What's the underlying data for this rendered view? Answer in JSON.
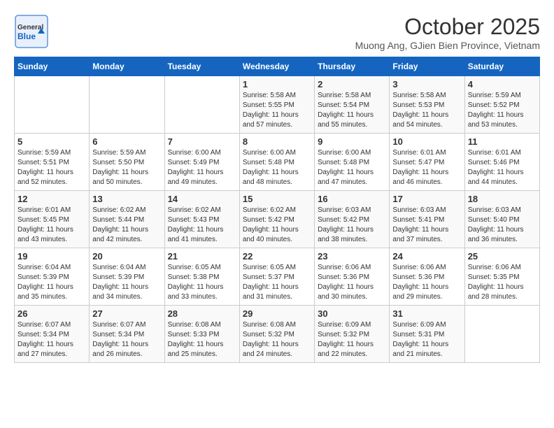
{
  "logo": {
    "line1": "General",
    "line2": "Blue"
  },
  "title": "October 2025",
  "location": "Muong Ang, GJien Bien Province, Vietnam",
  "days_of_week": [
    "Sunday",
    "Monday",
    "Tuesday",
    "Wednesday",
    "Thursday",
    "Friday",
    "Saturday"
  ],
  "weeks": [
    [
      {
        "day": "",
        "info": ""
      },
      {
        "day": "",
        "info": ""
      },
      {
        "day": "",
        "info": ""
      },
      {
        "day": "1",
        "info": "Sunrise: 5:58 AM\nSunset: 5:55 PM\nDaylight: 11 hours\nand 57 minutes."
      },
      {
        "day": "2",
        "info": "Sunrise: 5:58 AM\nSunset: 5:54 PM\nDaylight: 11 hours\nand 55 minutes."
      },
      {
        "day": "3",
        "info": "Sunrise: 5:58 AM\nSunset: 5:53 PM\nDaylight: 11 hours\nand 54 minutes."
      },
      {
        "day": "4",
        "info": "Sunrise: 5:59 AM\nSunset: 5:52 PM\nDaylight: 11 hours\nand 53 minutes."
      }
    ],
    [
      {
        "day": "5",
        "info": "Sunrise: 5:59 AM\nSunset: 5:51 PM\nDaylight: 11 hours\nand 52 minutes."
      },
      {
        "day": "6",
        "info": "Sunrise: 5:59 AM\nSunset: 5:50 PM\nDaylight: 11 hours\nand 50 minutes."
      },
      {
        "day": "7",
        "info": "Sunrise: 6:00 AM\nSunset: 5:49 PM\nDaylight: 11 hours\nand 49 minutes."
      },
      {
        "day": "8",
        "info": "Sunrise: 6:00 AM\nSunset: 5:48 PM\nDaylight: 11 hours\nand 48 minutes."
      },
      {
        "day": "9",
        "info": "Sunrise: 6:00 AM\nSunset: 5:48 PM\nDaylight: 11 hours\nand 47 minutes."
      },
      {
        "day": "10",
        "info": "Sunrise: 6:01 AM\nSunset: 5:47 PM\nDaylight: 11 hours\nand 46 minutes."
      },
      {
        "day": "11",
        "info": "Sunrise: 6:01 AM\nSunset: 5:46 PM\nDaylight: 11 hours\nand 44 minutes."
      }
    ],
    [
      {
        "day": "12",
        "info": "Sunrise: 6:01 AM\nSunset: 5:45 PM\nDaylight: 11 hours\nand 43 minutes."
      },
      {
        "day": "13",
        "info": "Sunrise: 6:02 AM\nSunset: 5:44 PM\nDaylight: 11 hours\nand 42 minutes."
      },
      {
        "day": "14",
        "info": "Sunrise: 6:02 AM\nSunset: 5:43 PM\nDaylight: 11 hours\nand 41 minutes."
      },
      {
        "day": "15",
        "info": "Sunrise: 6:02 AM\nSunset: 5:42 PM\nDaylight: 11 hours\nand 40 minutes."
      },
      {
        "day": "16",
        "info": "Sunrise: 6:03 AM\nSunset: 5:42 PM\nDaylight: 11 hours\nand 38 minutes."
      },
      {
        "day": "17",
        "info": "Sunrise: 6:03 AM\nSunset: 5:41 PM\nDaylight: 11 hours\nand 37 minutes."
      },
      {
        "day": "18",
        "info": "Sunrise: 6:03 AM\nSunset: 5:40 PM\nDaylight: 11 hours\nand 36 minutes."
      }
    ],
    [
      {
        "day": "19",
        "info": "Sunrise: 6:04 AM\nSunset: 5:39 PM\nDaylight: 11 hours\nand 35 minutes."
      },
      {
        "day": "20",
        "info": "Sunrise: 6:04 AM\nSunset: 5:39 PM\nDaylight: 11 hours\nand 34 minutes."
      },
      {
        "day": "21",
        "info": "Sunrise: 6:05 AM\nSunset: 5:38 PM\nDaylight: 11 hours\nand 33 minutes."
      },
      {
        "day": "22",
        "info": "Sunrise: 6:05 AM\nSunset: 5:37 PM\nDaylight: 11 hours\nand 31 minutes."
      },
      {
        "day": "23",
        "info": "Sunrise: 6:06 AM\nSunset: 5:36 PM\nDaylight: 11 hours\nand 30 minutes."
      },
      {
        "day": "24",
        "info": "Sunrise: 6:06 AM\nSunset: 5:36 PM\nDaylight: 11 hours\nand 29 minutes."
      },
      {
        "day": "25",
        "info": "Sunrise: 6:06 AM\nSunset: 5:35 PM\nDaylight: 11 hours\nand 28 minutes."
      }
    ],
    [
      {
        "day": "26",
        "info": "Sunrise: 6:07 AM\nSunset: 5:34 PM\nDaylight: 11 hours\nand 27 minutes."
      },
      {
        "day": "27",
        "info": "Sunrise: 6:07 AM\nSunset: 5:34 PM\nDaylight: 11 hours\nand 26 minutes."
      },
      {
        "day": "28",
        "info": "Sunrise: 6:08 AM\nSunset: 5:33 PM\nDaylight: 11 hours\nand 25 minutes."
      },
      {
        "day": "29",
        "info": "Sunrise: 6:08 AM\nSunset: 5:32 PM\nDaylight: 11 hours\nand 24 minutes."
      },
      {
        "day": "30",
        "info": "Sunrise: 6:09 AM\nSunset: 5:32 PM\nDaylight: 11 hours\nand 22 minutes."
      },
      {
        "day": "31",
        "info": "Sunrise: 6:09 AM\nSunset: 5:31 PM\nDaylight: 11 hours\nand 21 minutes."
      },
      {
        "day": "",
        "info": ""
      }
    ]
  ]
}
